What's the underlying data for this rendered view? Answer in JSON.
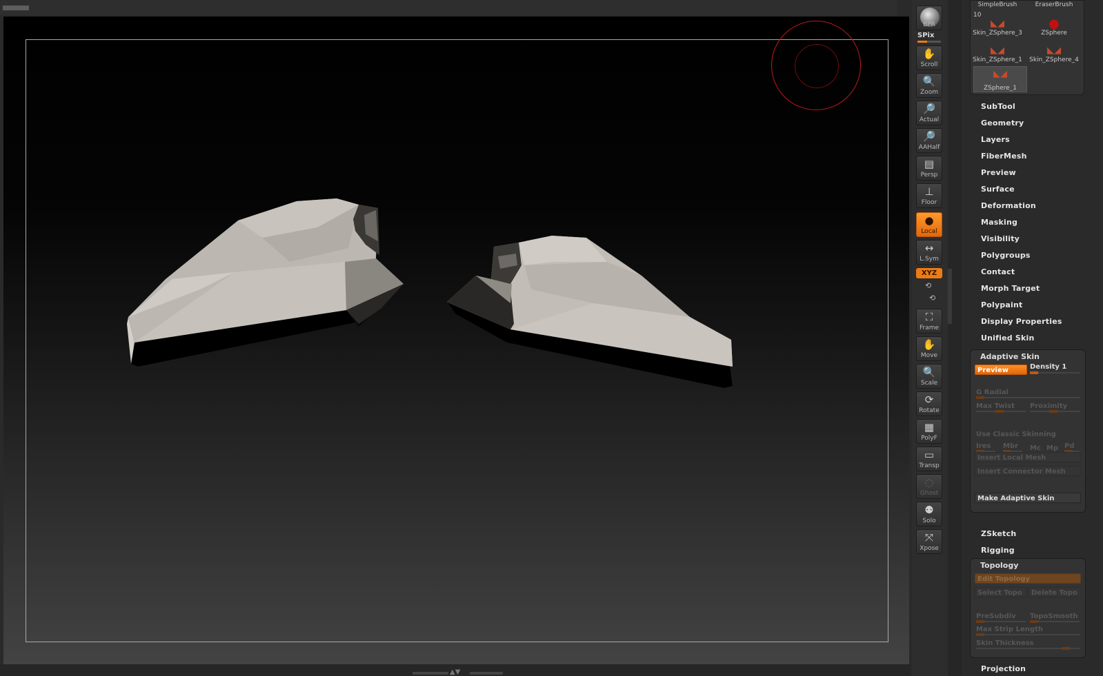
{
  "viewport": {
    "model_description": ""
  },
  "shelf": {
    "bpr": "BPR",
    "spix": "SPix",
    "spix_level": 0.4,
    "buttons": [
      {
        "name": "scroll-button",
        "label": "Scroll",
        "icon": "hand-icon",
        "glyph": "✋"
      },
      {
        "name": "zoom-button",
        "label": "Zoom",
        "icon": "magnifier-icon",
        "glyph": "🔍"
      },
      {
        "name": "actual-button",
        "label": "Actual",
        "icon": "magnifier-actual-icon",
        "glyph": "🔎"
      },
      {
        "name": "aahalf-button",
        "label": "AAHalf",
        "icon": "magnifier-half-icon",
        "glyph": "🔎"
      },
      {
        "name": "persp-button",
        "label": "Persp",
        "icon": "perspective-grid-icon",
        "glyph": "▤"
      },
      {
        "name": "floor-button",
        "label": "Floor",
        "icon": "floor-icon",
        "glyph": "⊥"
      },
      {
        "name": "local-button",
        "label": "Local",
        "icon": "local-rotate-icon",
        "glyph": "●"
      },
      {
        "name": "lsym-button",
        "label": "L.Sym",
        "icon": "symmetry-arrows-icon",
        "glyph": "↔"
      }
    ],
    "xyz": "XYZ",
    "buttons2": [
      {
        "name": "frame-button",
        "label": "Frame",
        "icon": "frame-icon",
        "glyph": "⛶"
      },
      {
        "name": "move-button",
        "label": "Move",
        "icon": "move-hand-icon",
        "glyph": "✋"
      },
      {
        "name": "scale-button",
        "label": "Scale",
        "icon": "scale-magnifier-icon",
        "glyph": "🔍"
      },
      {
        "name": "rotate-button",
        "label": "Rotate",
        "icon": "rotate-icon",
        "glyph": "⟳"
      },
      {
        "name": "polyf-button",
        "label": "PolyF",
        "icon": "polyframe-grid-icon",
        "glyph": "▦"
      },
      {
        "name": "transp-button",
        "label": "Transp",
        "icon": "transparency-icon",
        "glyph": "▭"
      },
      {
        "name": "ghost-button",
        "label": "Ghost",
        "icon": "ghost-icon",
        "glyph": "◌"
      },
      {
        "name": "solo-button",
        "label": "Solo",
        "icon": "solo-spheres-icon",
        "glyph": "⚉"
      },
      {
        "name": "xpose-button",
        "label": "Xpose",
        "icon": "xpose-arrows-icon",
        "glyph": "⤧"
      }
    ]
  },
  "brushes": {
    "number": "10",
    "items": [
      {
        "name": "SimpleBrush"
      },
      {
        "name": "EraserBrush"
      },
      {
        "name": "Skin_ZSphere_3"
      },
      {
        "name": "ZSphere"
      },
      {
        "name": "Skin_ZSphere_1"
      },
      {
        "name": "Skin_ZSphere_4"
      },
      {
        "name": "ZSphere_1"
      }
    ]
  },
  "menu": {
    "items": [
      "SubTool",
      "Geometry",
      "Layers",
      "FiberMesh",
      "Preview",
      "Surface",
      "Deformation",
      "Masking",
      "Visibility",
      "Polygroups",
      "Contact",
      "Morph Target",
      "Polypaint",
      "Display Properties",
      "Unified Skin"
    ]
  },
  "adaptive_skin": {
    "title": "Adaptive Skin",
    "preview": "Preview",
    "density": "Density 1",
    "g_radial": "G Radial",
    "max_twist": "Max Twist",
    "proximity": "Proximity",
    "use_classic": "Use Classic Skinning",
    "ires": "Ires",
    "mbr": "Mbr",
    "mc": "Mc",
    "mp": "Mp",
    "pd": "Pd",
    "insert_local": "Insert Local Mesh",
    "insert_connector": "Insert Connector Mesh",
    "make": "Make Adaptive Skin"
  },
  "menu2": {
    "zsketch": "ZSketch",
    "rigging": "Rigging"
  },
  "topology": {
    "title": "Topology",
    "edit": "Edit Topology",
    "select": "Select Topo",
    "delete": "Delete Topo",
    "presubdiv": "PreSubdiv",
    "toposmooth": "TopoSmooth",
    "max_strip": "Max Strip Length",
    "skin_thickness": "Skin Thickness"
  },
  "menu3": {
    "projection": "Projection"
  },
  "colors": {
    "accent": "#f07a10",
    "cursor_ring": "#c11a1a",
    "mesh": "#bcb8b1"
  }
}
